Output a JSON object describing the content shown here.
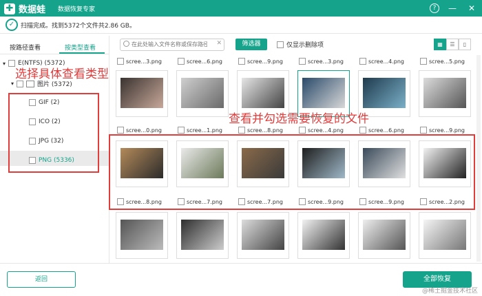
{
  "app": {
    "name": "数据蛙",
    "subtitle": "数据恢复专家",
    "help": "?",
    "minimize": "—",
    "close": "✕"
  },
  "status": {
    "text": "扫描完成。找到5372个文件共2.86 GB。",
    "check": "✓"
  },
  "sidebar": {
    "tab_path": "按路径查看",
    "tab_type": "按类型查看",
    "root": "E(NTFS) (5372)",
    "group": "图片 (5372)",
    "items": [
      {
        "label": "GIF (2)"
      },
      {
        "label": "ICO (2)"
      },
      {
        "label": "JPG (32)"
      },
      {
        "label": "PNG (5336)"
      }
    ]
  },
  "toolbar": {
    "search_placeholder": "在此处输入文件名称或保存路径",
    "filter_label": "筛选器",
    "only_deleted_label": "仅显示删除项",
    "view_icons": [
      "▦",
      "☰",
      "▯"
    ]
  },
  "files": {
    "row1_labels": [
      "scree...3.png",
      "scree...6.png",
      "scree...9.png",
      "scree...3.png",
      "scree...4.png",
      "scree...5.png"
    ],
    "row2_labels": [
      "scree...0.png",
      "scree...1.png",
      "scree...8.png",
      "scree...4.png",
      "scree...6.png",
      "scree...9.png"
    ],
    "row3_labels": [
      "scree...8.png",
      "scree...7.png",
      "scree...7.png",
      "scree...9.png",
      "scree...9.png",
      "scree...2.png"
    ],
    "row0_labels": [
      "scree...3.png",
      "scree...6.png",
      "scree...9.png",
      "scree...3.png",
      "scree...4.png",
      "scree...5.png"
    ]
  },
  "annotations": {
    "left": "选择具体查看类型",
    "center": "查看并勾选需要恢复的文件"
  },
  "footer": {
    "back_label": "返回",
    "recover_label": "全部恢复",
    "watermark": "@稀土掘金技术社区"
  },
  "colors": {
    "accent": "#15a38b",
    "annotation": "#e03c3c"
  }
}
